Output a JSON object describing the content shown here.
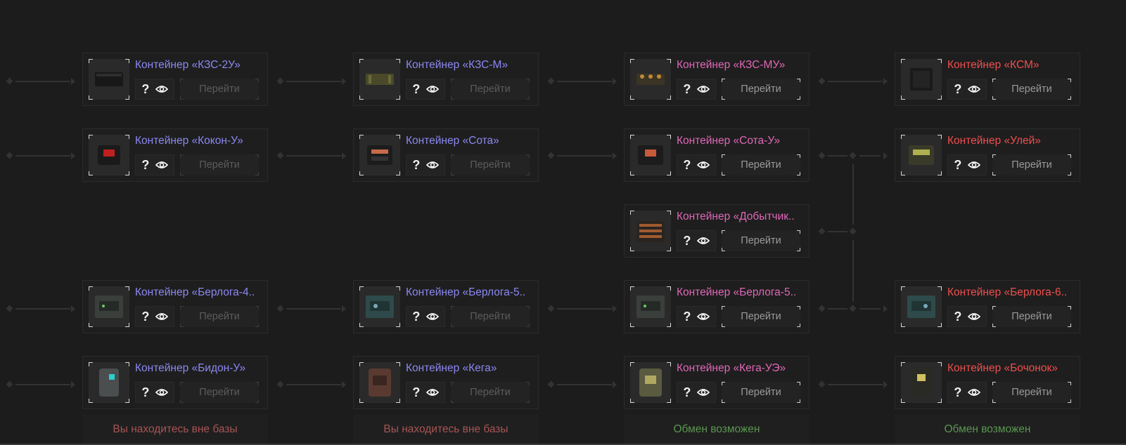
{
  "colors": {
    "tier1": "#8c88f2",
    "tier2": "#8c88f2",
    "tier3": "#e068b8",
    "tier4": "#f04e4e",
    "status_out": "#a85454",
    "status_ok": "#5a9650"
  },
  "columns": [
    {
      "cards": [
        {
          "title": "Контейнер «КЗС-2У»",
          "help": "?",
          "button": "Перейти",
          "icon": "container-kzs-icon"
        },
        {
          "title": "Контейнер «Кокон-У»",
          "help": "?",
          "button": "Перейти",
          "icon": "container-kokon-icon"
        },
        {
          "title": "Контейнер «Берлога-4..",
          "help": "?",
          "button": "Перейти",
          "icon": "container-berloga-icon"
        },
        {
          "title": "Контейнер «Бидон-У»",
          "help": "?",
          "button": "Перейти",
          "icon": "container-bidon-icon"
        }
      ],
      "footer": "Вы находитесь вне базы"
    },
    {
      "cards": [
        {
          "title": "Контейнер «КЗС-М»",
          "help": "?",
          "button": "Перейти",
          "icon": "container-kzs-icon"
        },
        {
          "title": "Контейнер «Сота»",
          "help": "?",
          "button": "Перейти",
          "icon": "container-sota-icon"
        },
        {
          "title": "Контейнер «Берлога-5..",
          "help": "?",
          "button": "Перейти",
          "icon": "container-berloga-icon"
        },
        {
          "title": "Контейнер «Кега»",
          "help": "?",
          "button": "Перейти",
          "icon": "container-kega-icon"
        }
      ],
      "footer": "Вы находитесь вне базы"
    },
    {
      "cards": [
        {
          "title": "Контейнер «КЗС-МУ»",
          "help": "?",
          "button": "Перейти",
          "icon": "container-kzs-icon"
        },
        {
          "title": "Контейнер «Сота-У»",
          "help": "?",
          "button": "Перейти",
          "icon": "container-sota-icon"
        },
        {
          "title": "Контейнер «Добытчик..",
          "help": "?",
          "button": "Перейти",
          "icon": "container-dobytchik-icon"
        },
        {
          "title": "Контейнер «Берлога-5..",
          "help": "?",
          "button": "Перейти",
          "icon": "container-berloga-icon"
        },
        {
          "title": "Контейнер «Кега-УЭ»",
          "help": "?",
          "button": "Перейти",
          "icon": "container-kega-icon"
        }
      ],
      "footer": "Обмен возможен"
    },
    {
      "cards": [
        {
          "title": "Контейнер «КСМ»",
          "help": "?",
          "button": "Перейти",
          "icon": "container-ksm-icon"
        },
        {
          "title": "Контейнер «Улей»",
          "help": "?",
          "button": "Перейти",
          "icon": "container-uley-icon"
        },
        {
          "title": "Контейнер «Берлога-6..",
          "help": "?",
          "button": "Перейти",
          "icon": "container-berloga-icon"
        },
        {
          "title": "Контейнер «Бочонок»",
          "help": "?",
          "button": "Перейти",
          "icon": "container-bochonok-icon"
        }
      ],
      "footer": "Обмен возможен"
    }
  ]
}
